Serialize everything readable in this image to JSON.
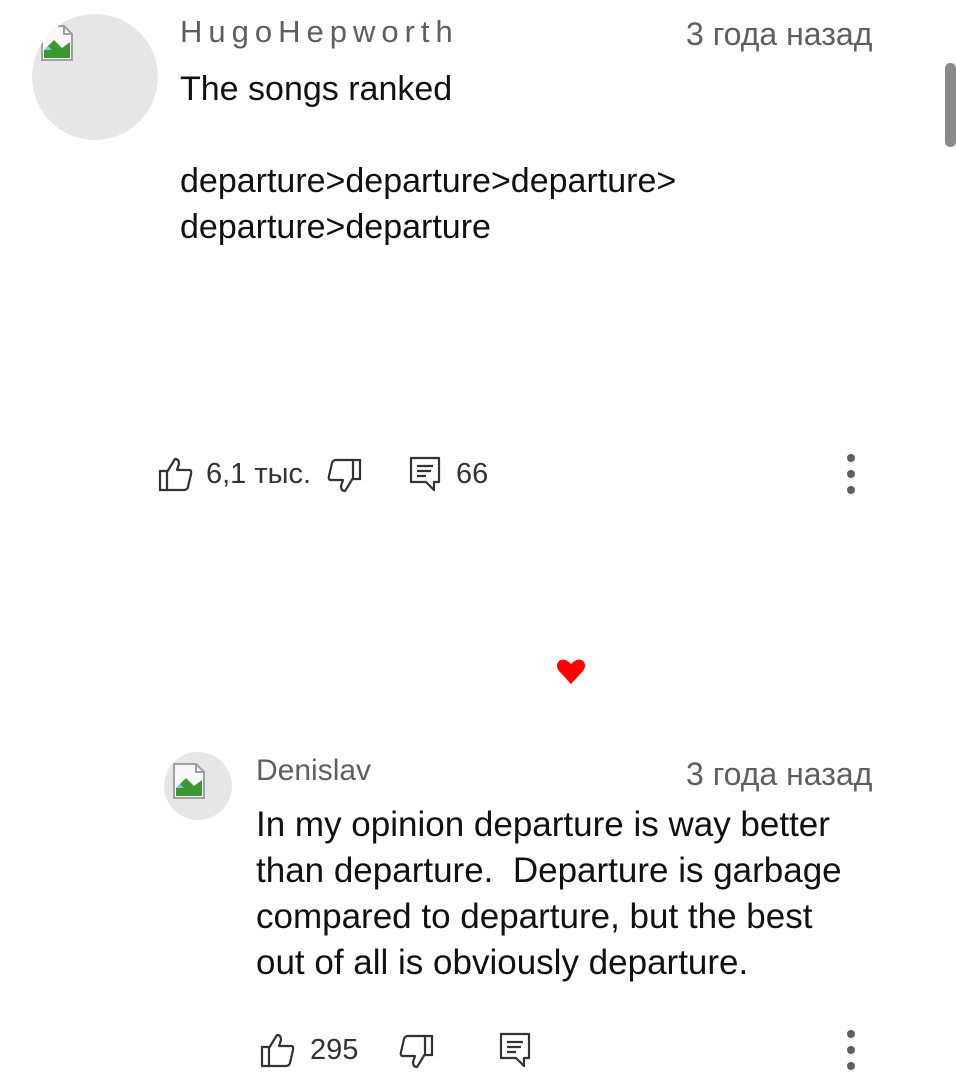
{
  "comments": [
    {
      "author": "HugoHepworth",
      "time": "3 года назад",
      "text": "The songs ranked\n\ndeparture>departure>departure>\ndeparture>departure",
      "likes": "6,1 тыс.",
      "replies": "66"
    },
    {
      "author": "Denislav",
      "time": "3 года назад",
      "text": "In my opinion departure is way better\nthan departure.  Departure is garbage\ncompared to departure, but the best\nout of all is obviously departure.",
      "likes": "295",
      "replies": ""
    }
  ],
  "colors": {
    "heart": "#ff0000",
    "meta_text": "#5f5f5f",
    "scrollbar": "#8a8a8a"
  }
}
